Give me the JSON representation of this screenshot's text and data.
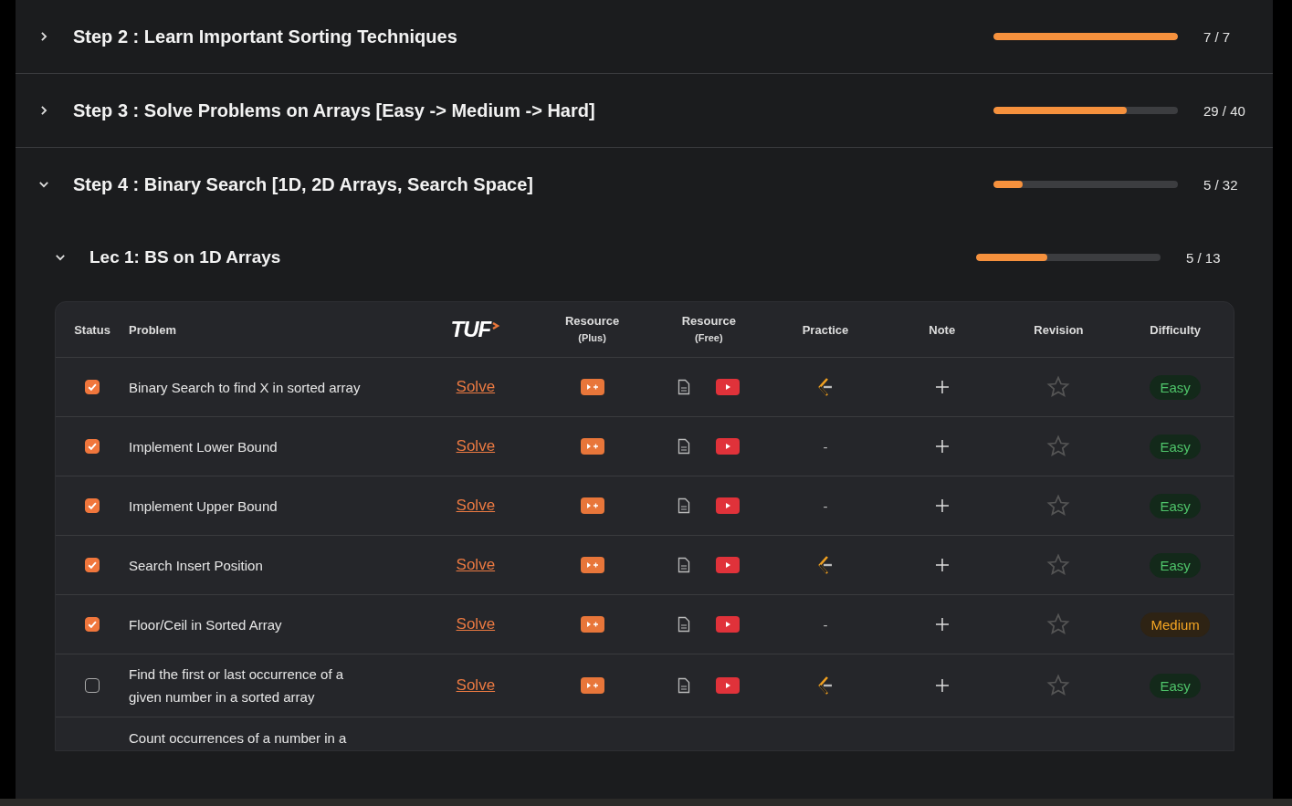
{
  "steps": [
    {
      "title": "Step 2 : Learn Important Sorting Techniques",
      "expanded": false,
      "level": 1,
      "count": "7 / 7"
    },
    {
      "title": "Step 3 : Solve Problems on Arrays [Easy -> Medium -> Hard]",
      "expanded": false,
      "level": 0.725,
      "count": "29 / 40"
    },
    {
      "title": "Step 4 : Binary Search [1D, 2D Arrays, Search Space]",
      "expanded": true,
      "level": 0.156,
      "count": "5 / 32",
      "lectures": [
        {
          "title": "Lec 1: BS on 1D Arrays",
          "expanded": true,
          "level": 0.385,
          "count": "5 / 13",
          "columns": [
            {
              "label": "Status",
              "kind": "text"
            },
            {
              "label": "Problem",
              "kind": "text"
            },
            {
              "label": "TUF",
              "kind": "logo"
            },
            {
              "label": "Resource",
              "sub": "(Plus)",
              "kind": "text"
            },
            {
              "label": "Resource",
              "sub": "(Free)",
              "kind": "text"
            },
            {
              "label": "Practice",
              "kind": "text"
            },
            {
              "label": "Note",
              "kind": "text"
            },
            {
              "label": "Revision",
              "kind": "text"
            },
            {
              "label": "Difficulty",
              "kind": "text"
            }
          ],
          "rows": [
            {
              "checked": true,
              "problem": "Binary Search to find X in sorted array",
              "solve": "Solve",
              "practice": {
                "kind": "icon"
              },
              "starred": false,
              "difficulty": {
                "label": "Easy",
                "kind": "easy"
              }
            },
            {
              "checked": true,
              "problem": "Implement Lower Bound",
              "solve": "Solve",
              "practice": {
                "kind": "text",
                "text": "-"
              },
              "starred": false,
              "difficulty": {
                "label": "Easy",
                "kind": "easy"
              }
            },
            {
              "checked": true,
              "problem": "Implement Upper Bound",
              "solve": "Solve",
              "practice": {
                "kind": "text",
                "text": "-"
              },
              "starred": false,
              "difficulty": {
                "label": "Easy",
                "kind": "easy"
              }
            },
            {
              "checked": true,
              "problem": "Search Insert Position",
              "solve": "Solve",
              "practice": {
                "kind": "icon"
              },
              "starred": false,
              "difficulty": {
                "label": "Easy",
                "kind": "easy"
              }
            },
            {
              "checked": true,
              "problem": "Floor/Ceil in Sorted Array",
              "solve": "Solve",
              "practice": {
                "kind": "text",
                "text": "-"
              },
              "starred": false,
              "difficulty": {
                "label": "Medium",
                "kind": "medium"
              }
            },
            {
              "checked": false,
              "problem": "Find the first or last occurrence of a given number in a sorted array",
              "solve": "Solve",
              "practice": {
                "kind": "icon"
              },
              "starred": false,
              "difficulty": {
                "label": "Easy",
                "kind": "easy"
              }
            }
          ],
          "partial_row": {
            "problem": "Count occurrences of a number in a"
          }
        }
      ]
    }
  ]
}
